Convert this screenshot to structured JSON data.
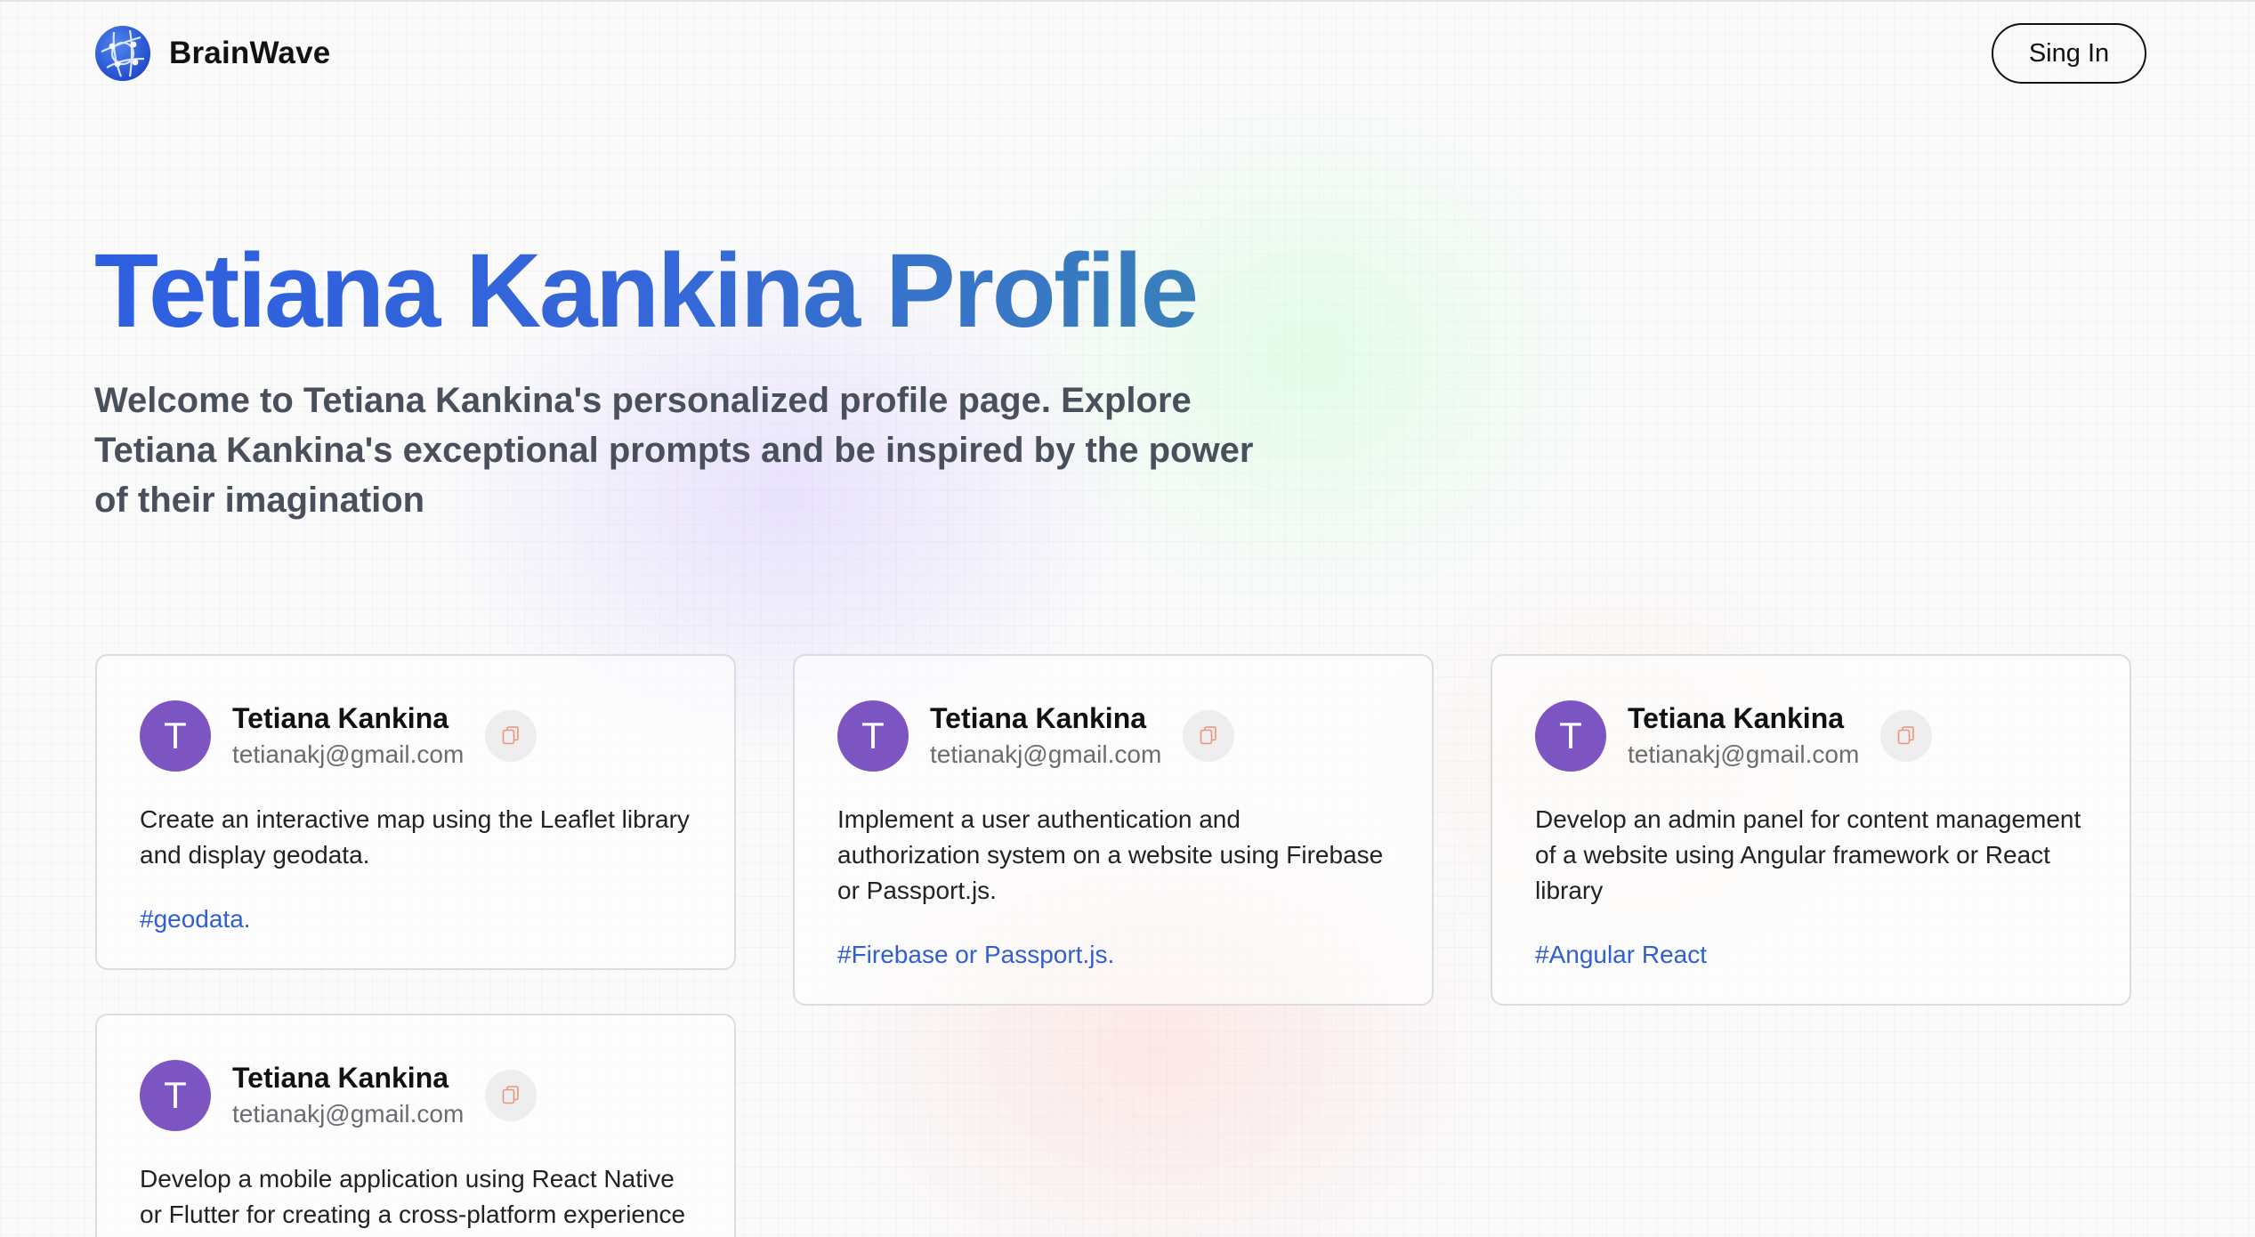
{
  "brand": {
    "name": "BrainWave",
    "logo_icon": "globe-network-icon",
    "accent": "#2d5fe0"
  },
  "nav": {
    "signin_label": "Sing In"
  },
  "hero": {
    "title": "Tetiana Kankina Profile",
    "description": "Welcome to Tetiana Kankina's personalized profile page. Explore Tetiana Kankina's exceptional prompts and be inspired by the power of their imagination"
  },
  "cards": [
    {
      "avatar_letter": "T",
      "name": "Tetiana Kankina",
      "email": "tetianakj@gmail.com",
      "copy_icon": "copy-icon",
      "prompt": "Create an interactive map using the Leaflet library and display geodata.",
      "tag": "#geodata."
    },
    {
      "avatar_letter": "T",
      "name": "Tetiana Kankina",
      "email": "tetianakj@gmail.com",
      "copy_icon": "copy-icon",
      "prompt": "Implement a user authentication and authorization system on a website using Firebase or Passport.js.",
      "tag": "#Firebase or Passport.js."
    },
    {
      "avatar_letter": "T",
      "name": "Tetiana Kankina",
      "email": "tetianakj@gmail.com",
      "copy_icon": "copy-icon",
      "prompt": "Develop an admin panel for content management of a website using Angular framework or React library",
      "tag": "#Angular React"
    },
    {
      "avatar_letter": "T",
      "name": "Tetiana Kankina",
      "email": "tetianakj@gmail.com",
      "copy_icon": "copy-icon",
      "prompt": "Develop a mobile application using React Native or Flutter for creating a cross-platform experience",
      "tag": ""
    }
  ],
  "colors": {
    "avatar_bg": "#7c55c2",
    "tag_text": "#2f5fd0",
    "copy_icon": "#e8967a"
  }
}
